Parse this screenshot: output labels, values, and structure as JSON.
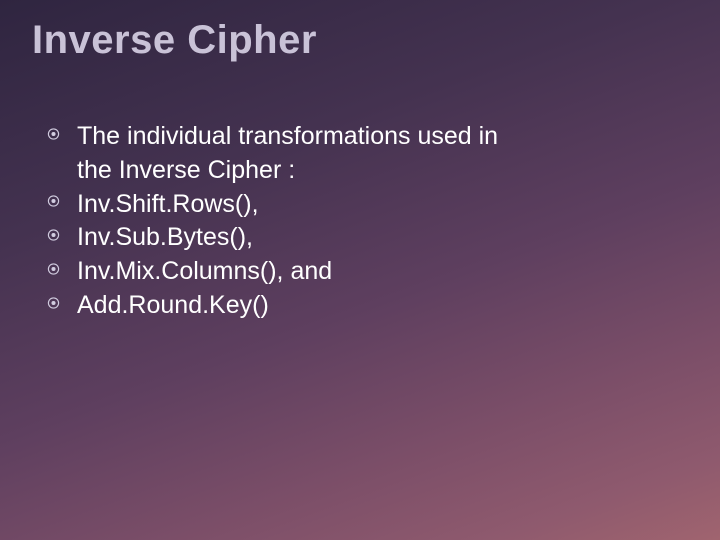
{
  "slide": {
    "title": "Inverse Cipher",
    "bullets": [
      {
        "line1": "The individual transformations used in",
        "line2": "the Inverse Cipher :"
      },
      {
        "line1": "Inv.Shift.Rows(),"
      },
      {
        "line1": "Inv.Sub.Bytes(),"
      },
      {
        "line1": "Inv.Mix.Columns(), and"
      },
      {
        "line1": "Add.Round.Key()"
      }
    ]
  }
}
